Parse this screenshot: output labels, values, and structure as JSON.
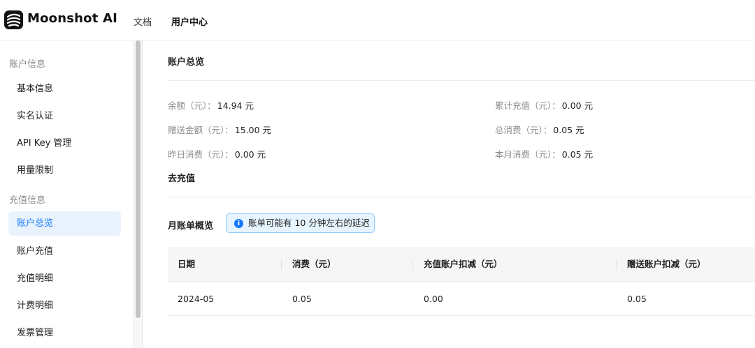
{
  "header": {
    "brand": "Moonshot AI",
    "nav": [
      {
        "label": "文档"
      },
      {
        "label": "用户中心"
      }
    ]
  },
  "sidebar": {
    "groups": [
      {
        "title": "账户信息",
        "items": [
          {
            "label": "基本信息"
          },
          {
            "label": "实名认证"
          },
          {
            "label": "API Key 管理"
          },
          {
            "label": "用量限制"
          }
        ]
      },
      {
        "title": "充值信息",
        "items": [
          {
            "label": "账户总览"
          },
          {
            "label": "账户充值"
          },
          {
            "label": "充值明细"
          },
          {
            "label": "计费明细"
          },
          {
            "label": "发票管理"
          }
        ]
      }
    ],
    "active_item": "账户总览"
  },
  "overview": {
    "title": "账户总览",
    "stats": [
      {
        "label": "余额（元）：",
        "value": "14.94 元"
      },
      {
        "label": "赠送金额（元）：",
        "value": "15.00 元"
      },
      {
        "label": "昨日消费（元）：",
        "value": "0.00 元"
      },
      {
        "label": "累计充值（元）：",
        "value": "0.00 元"
      },
      {
        "label": "总消费（元）：",
        "value": "0.05 元"
      },
      {
        "label": "本月消费（元）：",
        "value": "0.05 元"
      }
    ],
    "recharge_link": "去充值"
  },
  "monthly": {
    "title": "月账单概览",
    "notice": "账单可能有 10 分钟左右的延迟",
    "columns": [
      "日期",
      "消费（元）",
      "充值账户扣减（元）",
      "赠送账户扣减（元）"
    ],
    "rows": [
      [
        "2024-05",
        "0.05",
        "0.00",
        "0.05"
      ]
    ]
  },
  "colors": {
    "accent": "#1677ff",
    "active_bg": "#e9f3fd",
    "notice_border": "#91caff",
    "notice_bg": "#e6f4ff"
  }
}
